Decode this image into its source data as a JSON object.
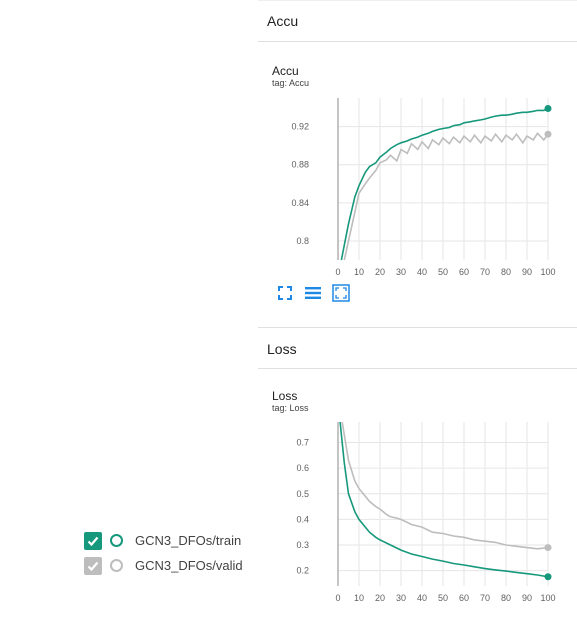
{
  "sections": [
    {
      "header": "Accu",
      "card_title": "Accu",
      "card_tag": "tag: Accu"
    },
    {
      "header": "Loss",
      "card_title": "Loss",
      "card_tag": "tag: Loss"
    }
  ],
  "toolbar": [
    "fit-domain-icon",
    "toggle-log-scale-icon",
    "expand-chart-icon"
  ],
  "legend": [
    {
      "label": "GCN3_DFOs/train",
      "color": "#16987c",
      "checked": true
    },
    {
      "label": "GCN3_DFOs/valid",
      "color": "#bdbdbd",
      "checked": true
    }
  ],
  "colors": {
    "train": "#16987c",
    "valid": "#bdbdbd",
    "accent": "#1e88e5"
  },
  "chart_data": [
    {
      "type": "line",
      "title": "Accu",
      "x_ticks": [
        0,
        10,
        20,
        30,
        40,
        50,
        60,
        70,
        80,
        90,
        100
      ],
      "y_ticks": [
        0.8,
        0.84,
        0.88,
        0.92
      ],
      "xlim": [
        0,
        100
      ],
      "ylim": [
        0.78,
        0.95
      ],
      "series": [
        {
          "name": "GCN3_DFOs/train",
          "color": "#16987c",
          "x": [
            0,
            5,
            8,
            10,
            13,
            15,
            18,
            20,
            23,
            25,
            28,
            30,
            33,
            35,
            38,
            40,
            43,
            45,
            48,
            50,
            53,
            55,
            58,
            60,
            63,
            65,
            68,
            70,
            73,
            75,
            78,
            80,
            83,
            85,
            88,
            90,
            93,
            95,
            98,
            100
          ],
          "y": [
            0.762,
            0.818,
            0.846,
            0.858,
            0.872,
            0.878,
            0.882,
            0.888,
            0.893,
            0.897,
            0.901,
            0.903,
            0.905,
            0.907,
            0.909,
            0.911,
            0.913,
            0.915,
            0.917,
            0.918,
            0.919,
            0.921,
            0.922,
            0.924,
            0.925,
            0.926,
            0.927,
            0.928,
            0.93,
            0.931,
            0.932,
            0.932,
            0.933,
            0.934,
            0.935,
            0.935,
            0.936,
            0.937,
            0.937,
            0.939
          ]
        },
        {
          "name": "GCN3_DFOs/valid",
          "color": "#bdbdbd",
          "x": [
            0,
            5,
            8,
            10,
            13,
            15,
            18,
            20,
            23,
            25,
            28,
            30,
            33,
            35,
            38,
            40,
            43,
            45,
            48,
            50,
            53,
            55,
            58,
            60,
            63,
            65,
            68,
            70,
            73,
            75,
            78,
            80,
            83,
            85,
            88,
            90,
            93,
            95,
            98,
            100
          ],
          "y": [
            0.75,
            0.8,
            0.83,
            0.85,
            0.86,
            0.866,
            0.874,
            0.882,
            0.885,
            0.89,
            0.884,
            0.896,
            0.892,
            0.902,
            0.896,
            0.904,
            0.897,
            0.906,
            0.901,
            0.908,
            0.902,
            0.909,
            0.903,
            0.91,
            0.904,
            0.911,
            0.903,
            0.91,
            0.905,
            0.912,
            0.904,
            0.911,
            0.906,
            0.912,
            0.903,
            0.91,
            0.906,
            0.913,
            0.906,
            0.912
          ]
        }
      ]
    },
    {
      "type": "line",
      "title": "Loss",
      "x_ticks": [
        0,
        10,
        20,
        30,
        40,
        50,
        60,
        70,
        80,
        90,
        100
      ],
      "y_ticks": [
        0.2,
        0.3,
        0.4,
        0.5,
        0.6,
        0.7
      ],
      "xlim": [
        0,
        100
      ],
      "ylim": [
        0.14,
        0.78
      ],
      "series": [
        {
          "name": "GCN3_DFOs/train",
          "color": "#16987c",
          "x": [
            1,
            3,
            5,
            8,
            10,
            13,
            15,
            18,
            20,
            25,
            30,
            35,
            40,
            45,
            50,
            55,
            60,
            65,
            70,
            75,
            80,
            85,
            90,
            95,
            100
          ],
          "y": [
            0.78,
            0.62,
            0.5,
            0.43,
            0.4,
            0.37,
            0.35,
            0.33,
            0.32,
            0.3,
            0.28,
            0.265,
            0.255,
            0.245,
            0.237,
            0.228,
            0.222,
            0.215,
            0.208,
            0.203,
            0.198,
            0.193,
            0.188,
            0.183,
            0.176
          ]
        },
        {
          "name": "GCN3_DFOs/valid",
          "color": "#bdbdbd",
          "x": [
            2,
            5,
            8,
            10,
            13,
            15,
            18,
            20,
            23,
            25,
            28,
            30,
            35,
            40,
            45,
            50,
            55,
            60,
            65,
            70,
            75,
            80,
            85,
            90,
            95,
            100
          ],
          "y": [
            0.78,
            0.63,
            0.55,
            0.52,
            0.49,
            0.47,
            0.45,
            0.44,
            0.42,
            0.41,
            0.405,
            0.4,
            0.38,
            0.37,
            0.35,
            0.345,
            0.335,
            0.33,
            0.32,
            0.315,
            0.31,
            0.3,
            0.295,
            0.29,
            0.285,
            0.29
          ]
        }
      ]
    }
  ]
}
